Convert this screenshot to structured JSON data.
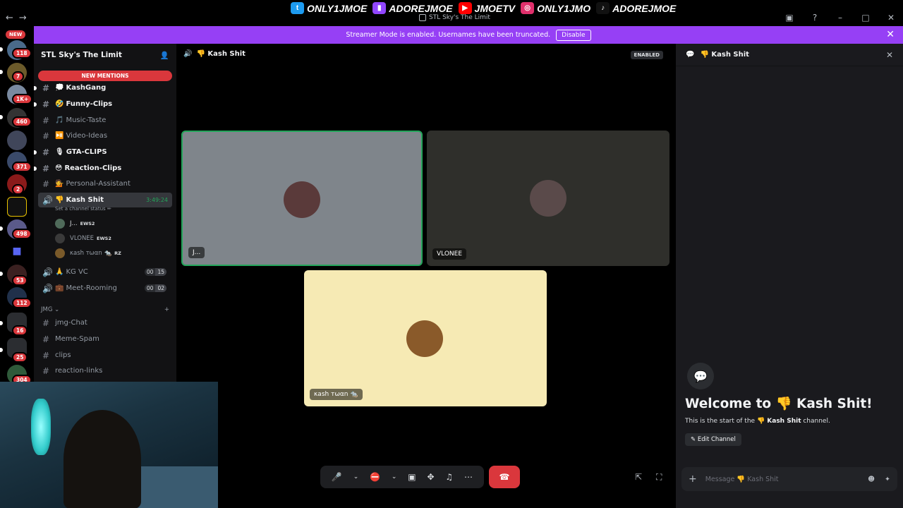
{
  "overlay": {
    "socials": [
      {
        "platform": "twitter-icon",
        "handle": "ONLY1JMOE",
        "color": "#1d9bf0"
      },
      {
        "platform": "twitch-icon",
        "handle": "ADOREJMOE",
        "color": "#9146ff"
      },
      {
        "platform": "youtube-icon",
        "handle": "JMOETV",
        "color": "#ff0000"
      },
      {
        "platform": "instagram-icon",
        "handle": "ONLY1JMO",
        "color": "#e1306c"
      },
      {
        "platform": "tiktok-icon",
        "handle": "ADOREJMOE",
        "color": "#25f4ee"
      }
    ]
  },
  "window": {
    "title": "STL Sky's The Limit"
  },
  "streamer_bar": {
    "message": "Streamer Mode is enabled. Usernames have been truncated.",
    "button": "Disable"
  },
  "rail": {
    "new_label": "NEW",
    "badges": [
      "118",
      "7",
      "1K+",
      "460",
      "371",
      "2",
      "498",
      "53",
      "112",
      "16",
      "25",
      "304"
    ]
  },
  "server": {
    "name": "STL Sky's The Limit",
    "mentions_label": "NEW MENTIONS"
  },
  "channels": [
    {
      "emoji": "💭",
      "name": "KashGang",
      "bold": true,
      "unread": true
    },
    {
      "emoji": "🤣",
      "name": "Funny-Clips",
      "bold": true,
      "unread": true
    },
    {
      "emoji": "🎵",
      "name": "Music-Taste",
      "bold": false
    },
    {
      "emoji": "⏯️",
      "name": "Video-Ideas",
      "bold": false
    },
    {
      "emoji": "🎙",
      "name": "GTA-CLIPS",
      "bold": true,
      "unread": true
    },
    {
      "emoji": "😳",
      "name": "Reaction-Clips",
      "bold": true,
      "unread": true
    },
    {
      "emoji": "💁",
      "name": "Personal-Assistant",
      "bold": false
    }
  ],
  "active_voice": {
    "emoji": "👎",
    "name": "Kash Shit",
    "timer": "3:49:24",
    "status": "Set a channel status ✏",
    "users": [
      {
        "name": "J...",
        "tag": "EWS2"
      },
      {
        "name": "VLONEE",
        "tag": "EWS2"
      },
      {
        "name": "κash тωαn 🐀",
        "tag": "RZ"
      }
    ]
  },
  "voice_channels": [
    {
      "emoji": "🙏",
      "name": "KG VC",
      "count_a": "00",
      "count_b": "15"
    },
    {
      "emoji": "💼",
      "name": "Meet-Rooming",
      "count_a": "00",
      "count_b": "02"
    }
  ],
  "category": {
    "name": "JMG",
    "channels": [
      "jmg-Chat",
      "Meme-Spam",
      "clips",
      "reaction-links"
    ]
  },
  "call": {
    "header": "👎 Kash Shit",
    "enabled_label": "ENABLED",
    "participants": [
      {
        "name": "J...",
        "bg": "#7f858b"
      },
      {
        "name": "VLONEE",
        "bg": "#2f2f2b"
      },
      {
        "name": "κash тωαn 🐀",
        "bg": "#f6eab4"
      }
    ]
  },
  "chat": {
    "header": "👎 Kash Shit",
    "welcome": "Welcome to 👎 Kash Shit!",
    "sub_prefix": "This is the start of the ",
    "sub_channel": "👎 Kash Shit",
    "sub_suffix": " channel.",
    "edit_label": "Edit Channel",
    "placeholder": "Message 👎 Kash Shit"
  }
}
